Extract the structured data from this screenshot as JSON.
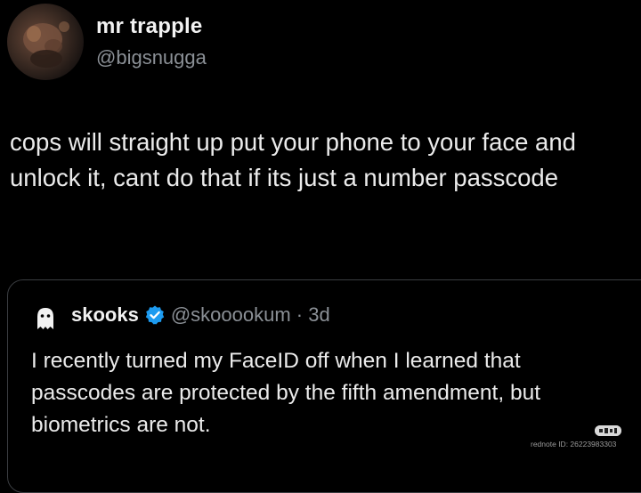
{
  "tweet": {
    "display_name": "mr trapple",
    "handle": "@bigsnugga",
    "text": "cops will straight up put your phone to your face and unlock it, cant do that if its just a number passcode",
    "avatar_icon": "profile-photo"
  },
  "quote": {
    "display_name": "skooks",
    "verified_icon": "verified-badge-icon",
    "handle_and_time": "@skooookum · 3d",
    "text": "I recently turned my FaceID off when I learned that passcodes are protected by the fifth amendment, but biometrics are not.",
    "avatar_icon": "ghost-icon"
  },
  "watermark": {
    "logo": "小红书",
    "text": "rednote ID: 26223983303"
  },
  "colors": {
    "background": "#000000",
    "text": "#ebebeb",
    "secondary_text": "#8b9096",
    "verified": "#1d9bf0",
    "border": "#3a3d41"
  }
}
